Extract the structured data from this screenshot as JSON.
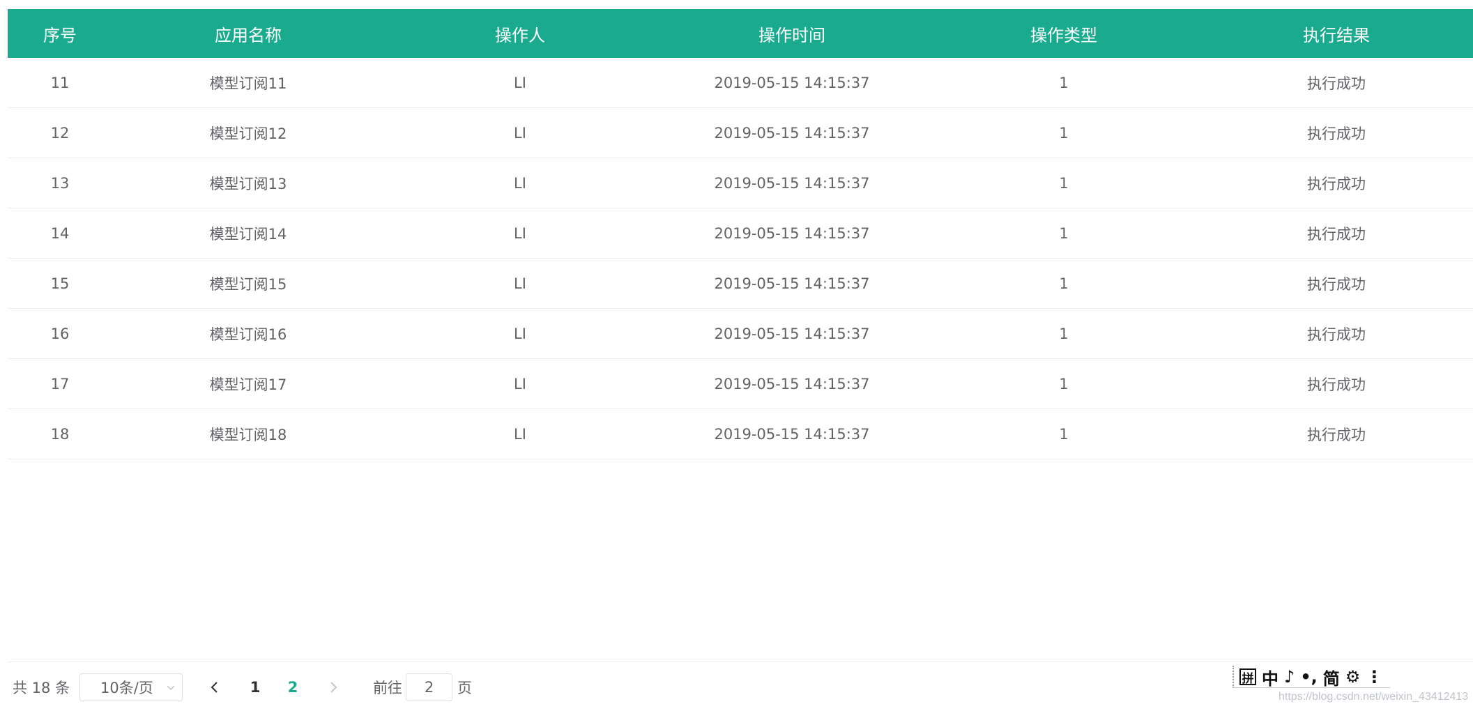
{
  "table": {
    "columns": [
      "序号",
      "应用名称",
      "操作人",
      "操作时间",
      "操作类型",
      "执行结果"
    ],
    "rows": [
      [
        "11",
        "模型订阅11",
        "LI",
        "2019-05-15 14:15:37",
        "1",
        "执行成功"
      ],
      [
        "12",
        "模型订阅12",
        "LI",
        "2019-05-15 14:15:37",
        "1",
        "执行成功"
      ],
      [
        "13",
        "模型订阅13",
        "LI",
        "2019-05-15 14:15:37",
        "1",
        "执行成功"
      ],
      [
        "14",
        "模型订阅14",
        "LI",
        "2019-05-15 14:15:37",
        "1",
        "执行成功"
      ],
      [
        "15",
        "模型订阅15",
        "LI",
        "2019-05-15 14:15:37",
        "1",
        "执行成功"
      ],
      [
        "16",
        "模型订阅16",
        "LI",
        "2019-05-15 14:15:37",
        "1",
        "执行成功"
      ],
      [
        "17",
        "模型订阅17",
        "LI",
        "2019-05-15 14:15:37",
        "1",
        "执行成功"
      ],
      [
        "18",
        "模型订阅18",
        "LI",
        "2019-05-15 14:15:37",
        "1",
        "执行成功"
      ]
    ]
  },
  "pagination": {
    "total_text": "共 18 条",
    "page_size_label": "10条/页",
    "prev_icon": "chevron-left-icon",
    "next_icon": "chevron-right-icon",
    "pages": [
      "1",
      "2"
    ],
    "current_page": "2",
    "goto_label": "前往",
    "goto_value": "2",
    "goto_unit": "页"
  },
  "ime_toolbar": {
    "items": [
      "拼",
      "中",
      "♪",
      "•,",
      "简",
      "⚙",
      "⋮"
    ]
  },
  "watermark": "https://blog.csdn.net/weixin_43412413",
  "colors": {
    "header_bg": "#1aab8e",
    "accent": "#1aab8e",
    "text": "#606266"
  }
}
